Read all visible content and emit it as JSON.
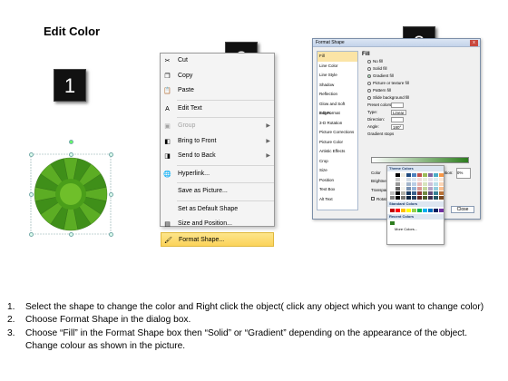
{
  "title": "Edit Color",
  "badges": [
    "1",
    "2",
    "3"
  ],
  "menu": {
    "items": [
      {
        "label": "Cut",
        "icon": "scissors-icon",
        "glyph": "✂",
        "disabled": false
      },
      {
        "label": "Copy",
        "icon": "copy-icon",
        "glyph": "❐",
        "disabled": false
      },
      {
        "label": "Paste",
        "icon": "paste-icon",
        "glyph": "📋",
        "disabled": false
      },
      {
        "label": "Edit Text",
        "icon": "edit-text-icon",
        "glyph": "A",
        "disabled": false,
        "sep_before": true
      },
      {
        "label": "Group",
        "icon": "group-icon",
        "glyph": "▣",
        "disabled": true,
        "sep_before": true,
        "submenu": true
      },
      {
        "label": "Bring to Front",
        "icon": "bring-to-front-icon",
        "glyph": "◧",
        "disabled": false,
        "submenu": true
      },
      {
        "label": "Send to Back",
        "icon": "send-to-back-icon",
        "glyph": "◨",
        "disabled": false,
        "submenu": true
      },
      {
        "label": "Hyperlink...",
        "icon": "hyperlink-icon",
        "glyph": "🌐",
        "disabled": false,
        "sep_before": true
      },
      {
        "label": "Save as Picture...",
        "icon": "",
        "glyph": "",
        "disabled": false,
        "sep_before": true
      },
      {
        "label": "Set as Default Shape",
        "icon": "",
        "glyph": "",
        "disabled": false,
        "sep_before": true
      },
      {
        "label": "Size and Position...",
        "icon": "size-position-icon",
        "glyph": "▤",
        "disabled": false
      },
      {
        "label": "Format Shape...",
        "icon": "format-shape-icon",
        "glyph": "🖌",
        "disabled": false,
        "highlighted": true
      }
    ]
  },
  "dialog": {
    "title": "Format Shape",
    "close": "x",
    "nav": [
      "Fill",
      "Line Color",
      "Line Style",
      "Shadow",
      "Reflection",
      "Glow and Soft Edges",
      "3-D Format",
      "3-D Rotation",
      "Picture Corrections",
      "Picture Color",
      "Artistic Effects",
      "Crop",
      "Size",
      "Position",
      "Text Box",
      "Alt Text"
    ],
    "section": "Fill",
    "options": [
      "No fill",
      "Solid fill",
      "Gradient fill",
      "Picture or texture fill",
      "Pattern fill",
      "Slide background fill"
    ],
    "selected_option": "Gradient fill",
    "fields": [
      {
        "label": "Preset colors:",
        "value": ""
      },
      {
        "label": "Type:",
        "value": "Linear"
      },
      {
        "label": "Direction:",
        "value": ""
      },
      {
        "label": "Angle:",
        "value": "180°"
      }
    ],
    "gradient_stops": "Gradient stops",
    "color": "Color",
    "position": "Position:",
    "position_value": "0%",
    "brightness": "Brightness",
    "transparency": "Transparency",
    "rotate": "Rotate with shape",
    "close_button": "Close"
  },
  "palette": {
    "theme_header": "Theme Colors",
    "standard_header": "Standard Colors",
    "recent_header": "Recent Colors",
    "more": "More Colors...",
    "theme_top": [
      "#ffffff",
      "#000000",
      "#eeece1",
      "#1f497d",
      "#4f81bd",
      "#c0504d",
      "#9bbb59",
      "#8064a2",
      "#4bacc6",
      "#f79646"
    ],
    "standard": [
      "#c00000",
      "#ff0000",
      "#ffc000",
      "#ffff00",
      "#92d050",
      "#00b050",
      "#00b0f0",
      "#0070c0",
      "#002060",
      "#7030a0"
    ],
    "recent": [
      "#2d7d1e"
    ]
  },
  "steps": [
    {
      "n": "1.",
      "text": "Select the shape to change the color and Right click the object( click any object which you want to change color)"
    },
    {
      "n": "2.",
      "text": "Choose Format Shape in the dialog box."
    },
    {
      "n": "3.",
      "text": "Choose “Fill” in the Format Shape box then “Solid” or “Gradient” depending on the appearance of the object. Change colour as shown in the picture."
    }
  ]
}
